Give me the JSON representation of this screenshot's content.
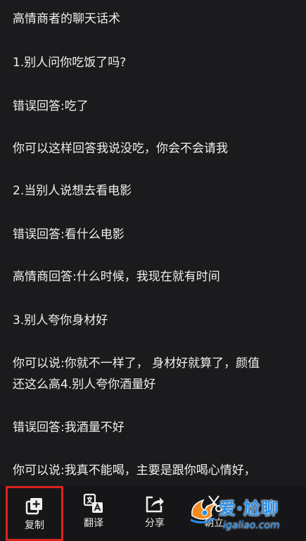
{
  "article": {
    "lines": [
      "高情商者的聊天话术",
      "1.别人问你吃饭了吗?",
      "错误回答:吃了",
      "你可以这样回答我说没吃，你会不会请我",
      "2.当别人说想去看电影",
      "错误回答:看什么电影",
      "高情商回答:什么时候，我现在就有时间",
      "3.别人夸你身材好",
      "你可以说:你就不一样了， 身材好就算了，颜值",
      "还这么高4.别人夸你酒量好",
      "错误回答:我酒量不好",
      "你可以说:我真不能喝，主要是跟你喝心情好，"
    ]
  },
  "toolbar": {
    "copy": {
      "label": "复制",
      "icon": "copy-plus-icon",
      "selected": true
    },
    "translate": {
      "label": "翻译",
      "icon": "translate-icon"
    },
    "share": {
      "label": "分享",
      "icon": "share-icon"
    },
    "fourth": {
      "label": "朝立",
      "icon": "scissors-icon"
    }
  },
  "watermark": {
    "title": "爱·尬聊",
    "url": "igaliao.com"
  },
  "colors": {
    "background": "#1b1b1d",
    "toolbar_background": "#161618",
    "highlight_border": "#d9231e",
    "watermark_blue": "#2b8ee8",
    "watermark_orange": "#f28a1e"
  }
}
